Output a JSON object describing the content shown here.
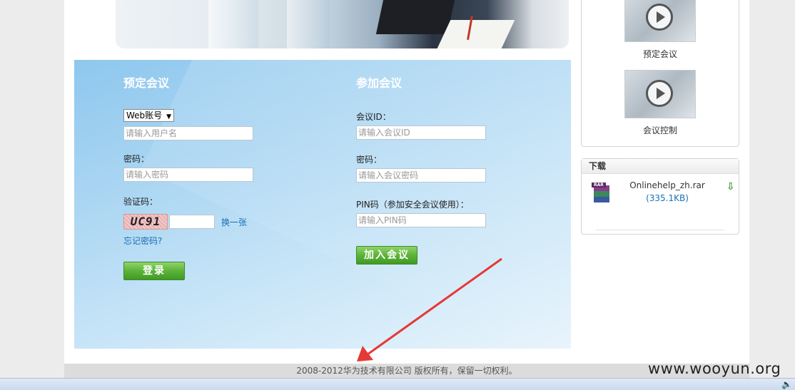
{
  "book_meeting": {
    "title": "预定会议",
    "account_type": "Web账号",
    "username_placeholder": "请输入用户名",
    "password_label": "密码：",
    "password_placeholder": "请输入密码",
    "captcha_label": "验证码：",
    "captcha_text": "UC91",
    "refresh_link": "换一张",
    "forgot_link": "忘记密码?",
    "login_button": "登录"
  },
  "join_meeting": {
    "title": "参加会议",
    "meeting_id_label": "会议ID：",
    "meeting_id_placeholder": "请输入会议ID",
    "password_label": "密码：",
    "password_placeholder": "请输入会议密码",
    "pin_label": "PIN码（参加安全会议使用）：",
    "pin_placeholder": "请输入PIN码",
    "join_button": "加入会议"
  },
  "sidebar": {
    "videos": [
      {
        "label": "预定会议",
        "icon": "play-icon"
      },
      {
        "label": "会议控制",
        "icon": "play-icon"
      }
    ],
    "download": {
      "header": "下载",
      "file_name": "Onlinehelp_zh.rar",
      "file_size": "(335.1KB)",
      "file_icon": "rar-archive-icon",
      "download_icon": "download-arrow-icon"
    }
  },
  "footer": {
    "copyright": "2008-2012华为技术有限公司 版权所有，保留一切权利。"
  },
  "watermark": "www.wooyun.org",
  "colors": {
    "login_bg": "#a9d5f2",
    "button_green": "#5cb339",
    "link_blue": "#1a6fb5",
    "annotation_arrow": "#e53935"
  }
}
